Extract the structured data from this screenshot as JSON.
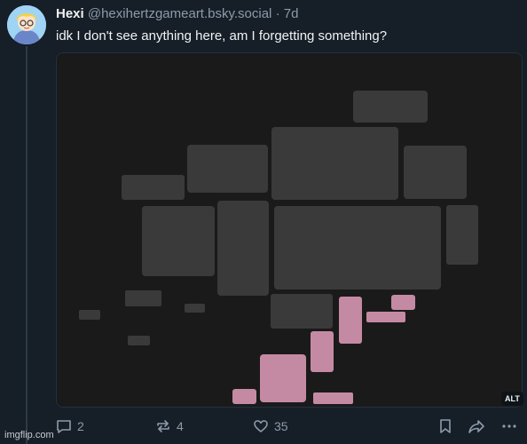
{
  "post": {
    "author": "Hexi",
    "handle": "@hexihertzgameart.bsky.social",
    "separator": "·",
    "time": "7d",
    "text": "idk I don't see anything here, am I forgetting something?"
  },
  "media": {
    "alt_badge": "ALT",
    "block_color": "#3a3a3a",
    "highlight_color": "#c58aa3",
    "background": "#1a1a1a"
  },
  "actions": {
    "reply_count": "2",
    "repost_count": "4",
    "like_count": "35"
  },
  "watermark": "imgflip.com",
  "colors": {
    "background": "#161e27",
    "muted": "#8c9bab",
    "text": "#f1f3f5"
  }
}
